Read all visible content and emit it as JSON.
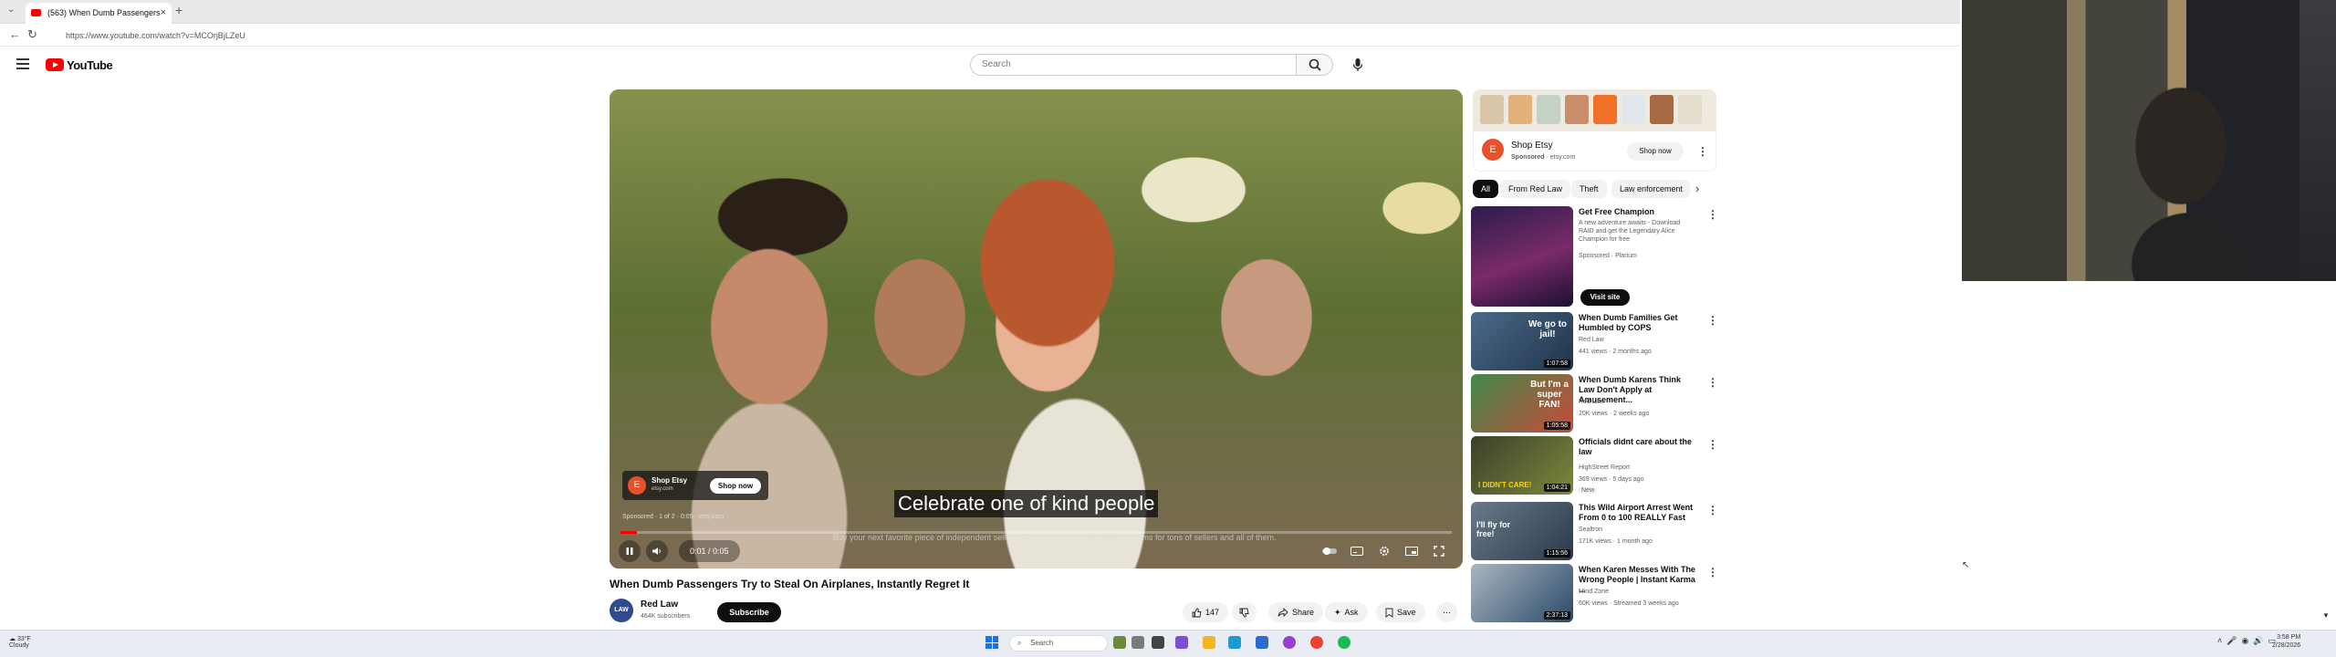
{
  "browser": {
    "tab_title": "(563) When Dumb Passengers",
    "new_tab": "+",
    "close": "×",
    "url": "https://www.youtube.com/watch?v=MCOrjBjLZeU"
  },
  "header": {
    "logo_text": "YouTube",
    "search_placeholder": "Search"
  },
  "player": {
    "caption": "Celebrate one of kind people",
    "subtext": "Buy your next favorite piece of independent sellers. Find items only. Sell individual items for tons of sellers and all of them.",
    "sponsor_line": "Sponsored · 1 of 2 · 0:05 · etsy.com",
    "progress": 0.02,
    "time": "0:01 / 0:05",
    "ad": {
      "logo_letter": "E",
      "title": "Shop Etsy",
      "domain": "etsy.com",
      "button": "Shop now"
    }
  },
  "video": {
    "title": "When Dumb Passengers Try to Steal On Airplanes, Instantly Regret It",
    "channel_name": "Red Law",
    "channel_avatar": "LAW",
    "subscribers": "464K subscribers",
    "subscribe": "Subscribe",
    "likes": "147",
    "share": "Share",
    "ask": "Ask",
    "save": "Save"
  },
  "side_ad": {
    "logo_letter": "E",
    "title": "Shop Etsy",
    "sponsored": "Sponsored",
    "domain": "etsy.com",
    "button": "Shop now"
  },
  "chips": [
    "All",
    "From Red Law",
    "Theft",
    "Law enforcement"
  ],
  "recommendations": [
    {
      "title": "Get Free Champion",
      "channel": "A new adventure awaits - Download RAID and get the Legendary Alice Champion for free",
      "meta": "Sponsored · Plarium",
      "button": "Visit site",
      "duration": ""
    },
    {
      "title": "When Dumb Families Get Humbled by COPS",
      "channel": "Red Law",
      "meta": "441 views · 2 months ago",
      "duration": "1:07:58",
      "thumb_text": "We go to jail!"
    },
    {
      "title": "When Dumb Karens Think Law Don't Apply at Amusement...",
      "channel": "Red Law",
      "meta": "20K views · 2 weeks ago",
      "duration": "1:05:58",
      "thumb_text": "But I'm a super FAN!"
    },
    {
      "title": "Officials didnt care about the law",
      "channel": "HighStreet Report",
      "meta": "369 views · 5 days ago",
      "badge": "New",
      "duration": "1:04:21",
      "thumb_text": "I DIDN'T CARE!"
    },
    {
      "title": "This Wild Airport Arrest Went From 0 to 100 REALLY Fast",
      "channel": "Sealtron",
      "meta": "171K views · 1 month ago",
      "duration": "1:15:56",
      "thumb_text": "I'll fly for free!"
    },
    {
      "title": "When Karen Messes With The Wrong People | Instant Karma ...",
      "channel": "Mind Zone",
      "meta": "60K views · Streamed 3 weeks ago",
      "duration": "2:37:13",
      "thumb_text": ""
    }
  ],
  "taskbar": {
    "weather_temp": "33°F",
    "weather_desc": "Cloudy",
    "search": "Search",
    "time": "3:58 PM",
    "date": "2/28/2026"
  },
  "colors": {
    "youtube_red": "#ff0000",
    "etsy_orange": "#e8502a",
    "text": "#0f0f0f",
    "secondary": "#606060"
  }
}
